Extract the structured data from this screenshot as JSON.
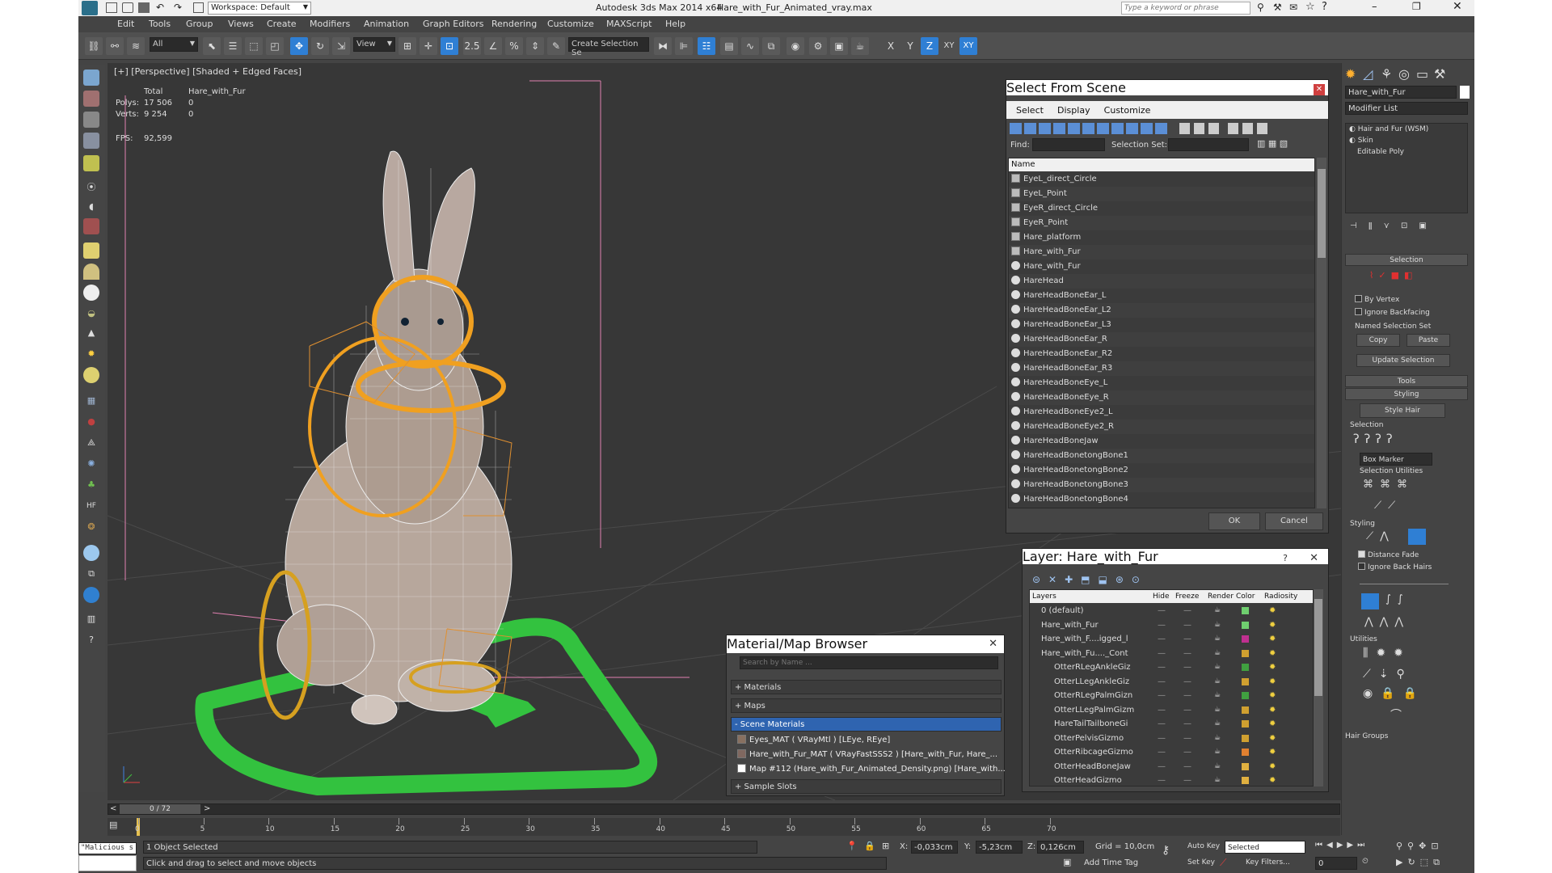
{
  "title": {
    "workspace": "Workspace: Default",
    "app": "Autodesk 3ds Max  2014 x64",
    "file": "Hare_with_Fur_Animated_vray.max",
    "search_placeholder": "Type a keyword or phrase"
  },
  "menu": [
    "Edit",
    "Tools",
    "Group",
    "Views",
    "Create",
    "Modifiers",
    "Animation",
    "Graph Editors",
    "Rendering",
    "Customize",
    "MAXScript",
    "Help"
  ],
  "toolbar": {
    "filter_value": "All",
    "refcoord_value": "View",
    "selection_set_value": "Create Selection Se",
    "axis_labels": [
      "X",
      "Y",
      "Z",
      "XY",
      "XY"
    ]
  },
  "viewport": {
    "label": "[+] [Perspective] [Shaded + Edged Faces]",
    "stats": {
      "total_label": "Total",
      "object_name": "Hare_with_Fur",
      "polys_label": "Polys:",
      "polys_total": "17 506",
      "polys_obj": "0",
      "verts_label": "Verts:",
      "verts_total": "9 254",
      "verts_obj": "0",
      "fps_label": "FPS:",
      "fps_value": "92,599"
    }
  },
  "select_from_scene": {
    "title": "Select From Scene",
    "menu": [
      "Select",
      "Display",
      "Customize"
    ],
    "find_label": "Find:",
    "selection_set_label": "Selection Set:",
    "name_header": "Name",
    "items": [
      {
        "name": "EyeL_direct_Circle",
        "icon": "shape"
      },
      {
        "name": "EyeL_Point",
        "icon": "helper"
      },
      {
        "name": "EyeR_direct_Circle",
        "icon": "shape"
      },
      {
        "name": "EyeR_Point",
        "icon": "helper"
      },
      {
        "name": "Hare_platform",
        "icon": "shape"
      },
      {
        "name": "Hare_with_Fur",
        "icon": "helper"
      },
      {
        "name": "Hare_with_Fur",
        "icon": "geometry"
      },
      {
        "name": "HareHead",
        "icon": "geometry"
      },
      {
        "name": "HareHeadBoneEar_L",
        "icon": "geometry"
      },
      {
        "name": "HareHeadBoneEar_L2",
        "icon": "geometry"
      },
      {
        "name": "HareHeadBoneEar_L3",
        "icon": "geometry"
      },
      {
        "name": "HareHeadBoneEar_R",
        "icon": "geometry"
      },
      {
        "name": "HareHeadBoneEar_R2",
        "icon": "geometry"
      },
      {
        "name": "HareHeadBoneEar_R3",
        "icon": "geometry"
      },
      {
        "name": "HareHeadBoneEye_L",
        "icon": "geometry"
      },
      {
        "name": "HareHeadBoneEye_R",
        "icon": "geometry"
      },
      {
        "name": "HareHeadBoneEye2_L",
        "icon": "geometry"
      },
      {
        "name": "HareHeadBoneEye2_R",
        "icon": "geometry"
      },
      {
        "name": "HareHeadBoneJaw",
        "icon": "geometry"
      },
      {
        "name": "HareHeadBonetongBone1",
        "icon": "geometry"
      },
      {
        "name": "HareHeadBonetongBone2",
        "icon": "geometry"
      },
      {
        "name": "HareHeadBonetongBone3",
        "icon": "geometry"
      },
      {
        "name": "HareHeadBonetongBone4",
        "icon": "geometry"
      }
    ],
    "ok": "OK",
    "cancel": "Cancel"
  },
  "layer_dialog": {
    "title": "Layer: Hare_with_Fur",
    "help": "?",
    "headers": [
      "Layers",
      "Hide",
      "Freeze",
      "Render",
      "Color",
      "Radiosity"
    ],
    "rows": [
      {
        "name": "0 (default)",
        "indent": 0,
        "color": "#6fcf6f"
      },
      {
        "name": "Hare_with_Fur",
        "indent": 0,
        "color": "#6fcf6f"
      },
      {
        "name": "Hare_with_F....igged_l",
        "indent": 0,
        "color": "#c03090"
      },
      {
        "name": "Hare_with_Fu...._Cont",
        "indent": 0,
        "color": "#d0a030"
      },
      {
        "name": "OtterRLegAnkleGiz",
        "indent": 1,
        "color": "#40a040"
      },
      {
        "name": "OtterLLegAnkleGiz",
        "indent": 1,
        "color": "#d0a030"
      },
      {
        "name": "OtterRLegPalmGizn",
        "indent": 1,
        "color": "#40a040"
      },
      {
        "name": "OtterLLegPalmGizm",
        "indent": 1,
        "color": "#d0a030"
      },
      {
        "name": "HareTailTailboneGi",
        "indent": 1,
        "color": "#d0a030"
      },
      {
        "name": "OtterPelvisGizmo",
        "indent": 1,
        "color": "#d0a030"
      },
      {
        "name": "OtterRibcageGizmo",
        "indent": 1,
        "color": "#e08030"
      },
      {
        "name": "OtterHeadBoneJaw",
        "indent": 1,
        "color": "#e0b040"
      },
      {
        "name": "OtterHeadGizmo",
        "indent": 1,
        "color": "#e0b040"
      }
    ]
  },
  "material_browser": {
    "title": "Material/Map Browser",
    "search_placeholder": "Search by Name ...",
    "sections": [
      "+ Materials",
      "+ Maps",
      "- Scene Materials",
      "+ Sample Slots"
    ],
    "scene_materials": [
      "Eyes_MAT  ( VRayMtl )  [LEye, REye]",
      "Hare_with_Fur_MAT  ( VRayFastSSS2 )  [Hare_with_Fur, Hare_...",
      "Map #112 (Hare_with_Fur_Animated_Density.png) [Hare_with..."
    ]
  },
  "command_panel": {
    "object_name": "Hare_with_Fur",
    "modifier_list": "Modifier List",
    "stack": [
      "Hair and Fur (WSM)",
      "Skin",
      "Editable Poly"
    ],
    "selection_rollout": "Selection",
    "by_vertex": "By Vertex",
    "ignore_backfacing": "Ignore Backfacing",
    "named_selection_set": "Named Selection Set",
    "copy": "Copy",
    "paste": "Paste",
    "update_selection": "Update Selection",
    "tools_rollout": "Tools",
    "styling_rollout": "Styling",
    "style_hair": "Style Hair",
    "selection_group": "Selection",
    "box_marker": "Box Marker",
    "selection_utilities": "Selection Utilities",
    "styling_group": "Styling",
    "distance_fade": "Distance Fade",
    "ignore_back_hairs": "Ignore Back Hairs",
    "utilities_group": "Utilities",
    "hair_groups": "Hair Groups"
  },
  "timeline": {
    "frame_display": "0 / 72",
    "ticks": [
      "0",
      "5",
      "10",
      "15",
      "20",
      "25",
      "30",
      "35",
      "40",
      "45",
      "50",
      "55",
      "60",
      "65",
      "70"
    ]
  },
  "status": {
    "maxscript": "\"Malicious s",
    "selected_count": "1 Object Selected",
    "prompt": "Click and drag to select and move objects",
    "x_label": "X:",
    "x_value": "-0,033cm",
    "y_label": "Y:",
    "y_value": "-5,23cm",
    "z_label": "Z:",
    "z_value": "0,126cm",
    "grid": "Grid = 10,0cm",
    "add_time_tag": "Add Time Tag",
    "auto_key": "Auto Key",
    "selected_dropdown": "Selected",
    "set_key": "Set Key",
    "key_filters": "Key Filters...",
    "frame_value": "0"
  }
}
